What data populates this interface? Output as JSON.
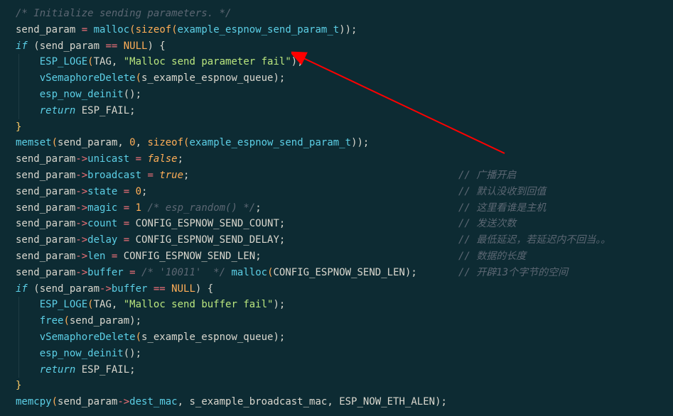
{
  "code": {
    "l1": "/* Initialize sending parameters. */",
    "l2": {
      "a": "send_param",
      "b": " = ",
      "c": "malloc",
      "d": "(",
      "e": "sizeof",
      "f": "(",
      "g": "example_espnow_send_param_t",
      "h": "));"
    },
    "l3": {
      "a": "if",
      "b": " (",
      "c": "send_param",
      "d": " == ",
      "e": "NULL",
      "f": ") {"
    },
    "l4": {
      "a": "ESP_LOGE",
      "b": "(",
      "c": "TAG",
      "d": ", ",
      "e": "\"Malloc send parameter fail\"",
      "f": ");"
    },
    "l5": {
      "a": "vSemaphoreDelete",
      "b": "(",
      "c": "s_example_espnow_queue",
      "d": ");"
    },
    "l6": {
      "a": "esp_now_deinit",
      "b": "();"
    },
    "l7": {
      "a": "return",
      "b": " ESP_FAIL",
      "c": ";"
    },
    "l8": "}",
    "l9": {
      "a": "memset",
      "b": "(",
      "c": "send_param",
      "d": ", ",
      "e": "0",
      "f": ", ",
      "g": "sizeof",
      "h": "(",
      "i": "example_espnow_send_param_t",
      "j": "));"
    },
    "l10": {
      "a": "send_param",
      "b": "->",
      "c": "unicast",
      "d": " = ",
      "e": "false",
      "f": ";"
    },
    "l11": {
      "a": "send_param",
      "b": "->",
      "c": "broadcast",
      "d": " = ",
      "e": "true",
      "f": ";",
      "cmt": "// 广播开启"
    },
    "l12": {
      "a": "send_param",
      "b": "->",
      "c": "state",
      "d": " = ",
      "e": "0",
      "f": ";",
      "cmt": "// 默认没收到回值"
    },
    "l13": {
      "a": "send_param",
      "b": "->",
      "c": "magic",
      "d": " = ",
      "e": "1",
      "g": " /* esp_random() */",
      "f": ";",
      "cmt": "// 这里看谁是主机"
    },
    "l14": {
      "a": "send_param",
      "b": "->",
      "c": "count",
      "d": " = ",
      "e": "CONFIG_ESPNOW_SEND_COUNT",
      "f": ";",
      "cmt": "// 发送次数"
    },
    "l15": {
      "a": "send_param",
      "b": "->",
      "c": "delay",
      "d": " = ",
      "e": "CONFIG_ESPNOW_SEND_DELAY",
      "f": ";",
      "cmt": "// 最低延迟，若延迟内不回当。。"
    },
    "l16": {
      "a": "send_param",
      "b": "->",
      "c": "len",
      "d": " = ",
      "e": "CONFIG_ESPNOW_SEND_LEN",
      "f": ";",
      "cmt": "// 数据的长度"
    },
    "l17": {
      "a": "send_param",
      "b": "->",
      "c": "buffer",
      "d": " = ",
      "pre": "/* '10011'  */",
      "g": " malloc",
      "h": "(",
      "i": "CONFIG_ESPNOW_SEND_LEN",
      "j": ");",
      "cmt": "// 开辟13个字节的空间"
    },
    "l18": {
      "a": "if",
      "b": " (",
      "c": "send_param",
      "d": "->",
      "e": "buffer",
      "f": " == ",
      "g": "NULL",
      "h": ") {"
    },
    "l19": {
      "a": "ESP_LOGE",
      "b": "(",
      "c": "TAG",
      "d": ", ",
      "e": "\"Malloc send buffer fail\"",
      "f": ");"
    },
    "l20": {
      "a": "free",
      "b": "(",
      "c": "send_param",
      "d": ");"
    },
    "l21": {
      "a": "vSemaphoreDelete",
      "b": "(",
      "c": "s_example_espnow_queue",
      "d": ");"
    },
    "l22": {
      "a": "esp_now_deinit",
      "b": "();"
    },
    "l23": {
      "a": "return",
      "b": " ESP_FAIL",
      "c": ";"
    },
    "l24": "}",
    "l25": {
      "a": "memcpy",
      "b": "(",
      "c": "send_param",
      "d": "->",
      "e": "dest_mac",
      "f": ", ",
      "g": "s_example_broadcast_mac",
      "h": ", ",
      "i": "ESP_NOW_ETH_ALEN",
      "j": ");"
    }
  }
}
